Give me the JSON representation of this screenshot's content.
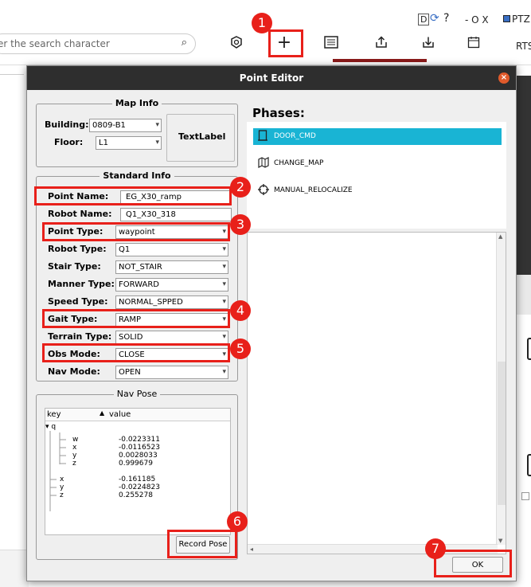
{
  "app": {
    "search_placeholder": "er the search character",
    "search_icon": "⌕",
    "window_indicators": "D",
    "window_controls": "- O X",
    "ptz_label": "PTZ",
    "rts_label": "RTS",
    "toolbar_icons": [
      "at-icon",
      "plus-icon",
      "list-icon",
      "upload-icon",
      "download-icon",
      "calendar-icon"
    ]
  },
  "dialog": {
    "title": "Point Editor",
    "map_info": {
      "title": "Map Info",
      "building_label": "Building:",
      "building_value": "0809-B1",
      "floor_label": "Floor:",
      "floor_value": "L1",
      "text_label": "TextLabel"
    },
    "standard_info": {
      "title": "Standard Info",
      "fields": [
        {
          "label": "Point Name:",
          "value": "EG_X30_ramp",
          "kind": "field"
        },
        {
          "label": "Robot Name:",
          "value": "Q1_X30_318",
          "kind": "field"
        },
        {
          "label": "Point Type:",
          "value": "waypoint",
          "kind": "combo"
        },
        {
          "label": "Robot Type:",
          "value": "Q1",
          "kind": "combo"
        },
        {
          "label": "Stair Type:",
          "value": "NOT_STAIR",
          "kind": "combo"
        },
        {
          "label": "Manner Type:",
          "value": "FORWARD",
          "kind": "combo"
        },
        {
          "label": "Speed Type:",
          "value": "NORMAL_SPPED",
          "kind": "combo"
        },
        {
          "label": "Gait Type:",
          "value": "RAMP",
          "kind": "combo"
        },
        {
          "label": "Terrain Type:",
          "value": "SOLID",
          "kind": "combo"
        },
        {
          "label": "Obs Mode:",
          "value": "CLOSE",
          "kind": "combo"
        },
        {
          "label": "Nav Mode:",
          "value": "OPEN",
          "kind": "combo"
        }
      ]
    },
    "nav_pose": {
      "title": "Nav Pose",
      "col_key": "key",
      "col_value": "value",
      "rows": [
        {
          "key": "q",
          "value": ""
        },
        {
          "key": "w",
          "value": "-0.0223311"
        },
        {
          "key": "x",
          "value": "-0.0116523"
        },
        {
          "key": "y",
          "value": "0.0028033"
        },
        {
          "key": "z",
          "value": "0.999679"
        },
        {
          "key": "x",
          "value": "-0.161185"
        },
        {
          "key": "y",
          "value": "-0.0224823"
        },
        {
          "key": "z",
          "value": "0.255278"
        }
      ]
    },
    "record_pose_label": "Record Pose",
    "phases": {
      "title": "Phases:",
      "items": [
        {
          "label": "DOOR_CMD",
          "icon": "door-icon",
          "selected": true
        },
        {
          "label": "CHANGE_MAP",
          "icon": "map-icon",
          "selected": false
        },
        {
          "label": "MANUAL_RELOCALIZE",
          "icon": "crosshair-icon",
          "selected": false
        }
      ]
    },
    "ok_label": "OK"
  },
  "annotations": {
    "badges": [
      "1",
      "2",
      "3",
      "4",
      "5",
      "6",
      "7"
    ],
    "highlight_color": "#e8201a"
  },
  "colors": {
    "selected_phase": "#19b4d4",
    "titlebar": "#2e2e2e",
    "close_button": "#e05a2b"
  }
}
